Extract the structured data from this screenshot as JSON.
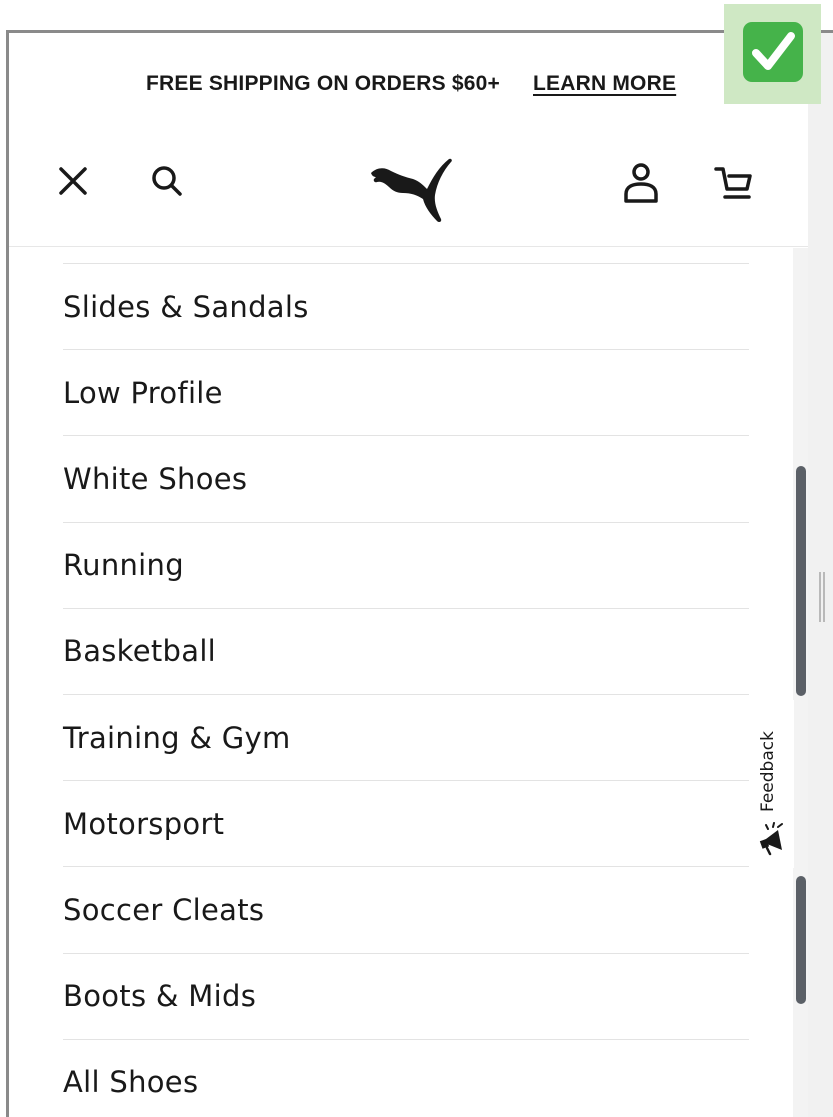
{
  "banner": {
    "text": "FREE SHIPPING ON ORDERS $60+",
    "link": "LEARN MORE"
  },
  "header": {
    "icons": [
      "close-icon",
      "search-icon",
      "puma-logo",
      "account-icon",
      "cart-icon"
    ]
  },
  "menu": {
    "items": [
      "Slides & Sandals",
      "Low Profile",
      "White Shoes",
      "Running",
      "Basketball",
      "Training & Gym",
      "Motorsport",
      "Soccer Cleats",
      "Boots & Mids",
      "All Shoes"
    ]
  },
  "feedback": {
    "label": "Feedback"
  },
  "colors": {
    "text": "#191919",
    "badge_green": "#45b34a",
    "badge_bg": "#cfe8c4",
    "scrollbar": "#5b6067"
  }
}
